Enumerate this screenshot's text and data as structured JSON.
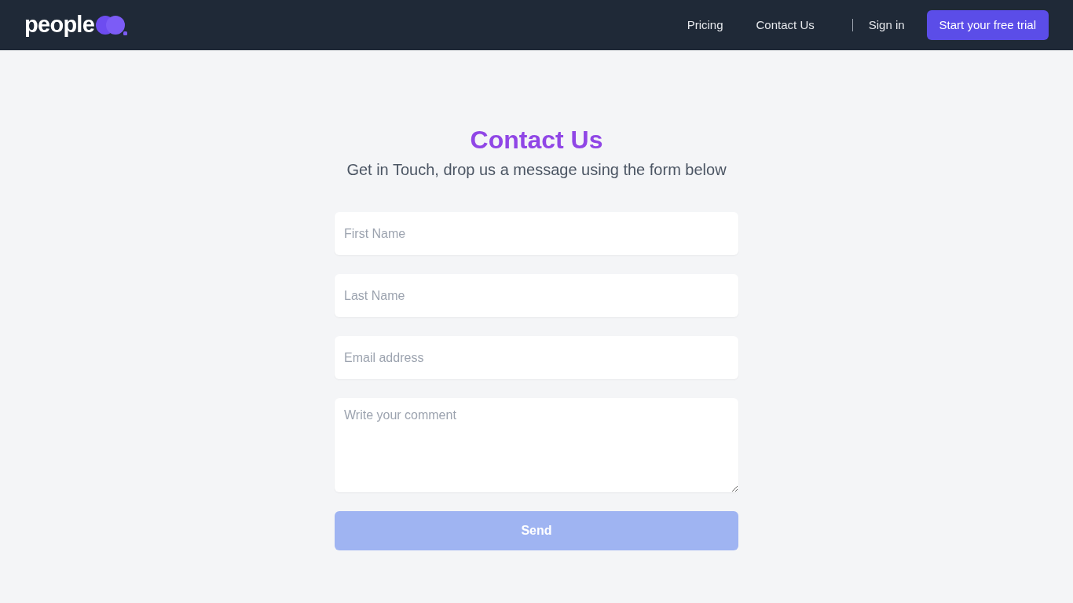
{
  "header": {
    "logo_text": "people",
    "nav": [
      {
        "label": "Pricing"
      },
      {
        "label": "Contact Us"
      }
    ],
    "sign_in": "Sign in",
    "cta": "Start your free trial"
  },
  "main": {
    "title": "Contact Us",
    "subtitle": "Get in Touch, drop us a message using the form below",
    "fields": [
      {
        "kind": "input",
        "placeholder": "First Name"
      },
      {
        "kind": "input",
        "placeholder": "Last Name"
      },
      {
        "kind": "input",
        "placeholder": "Email address"
      },
      {
        "kind": "textarea",
        "placeholder": "Write your comment"
      }
    ],
    "submit": {
      "label": "Send",
      "disabled": true
    }
  }
}
